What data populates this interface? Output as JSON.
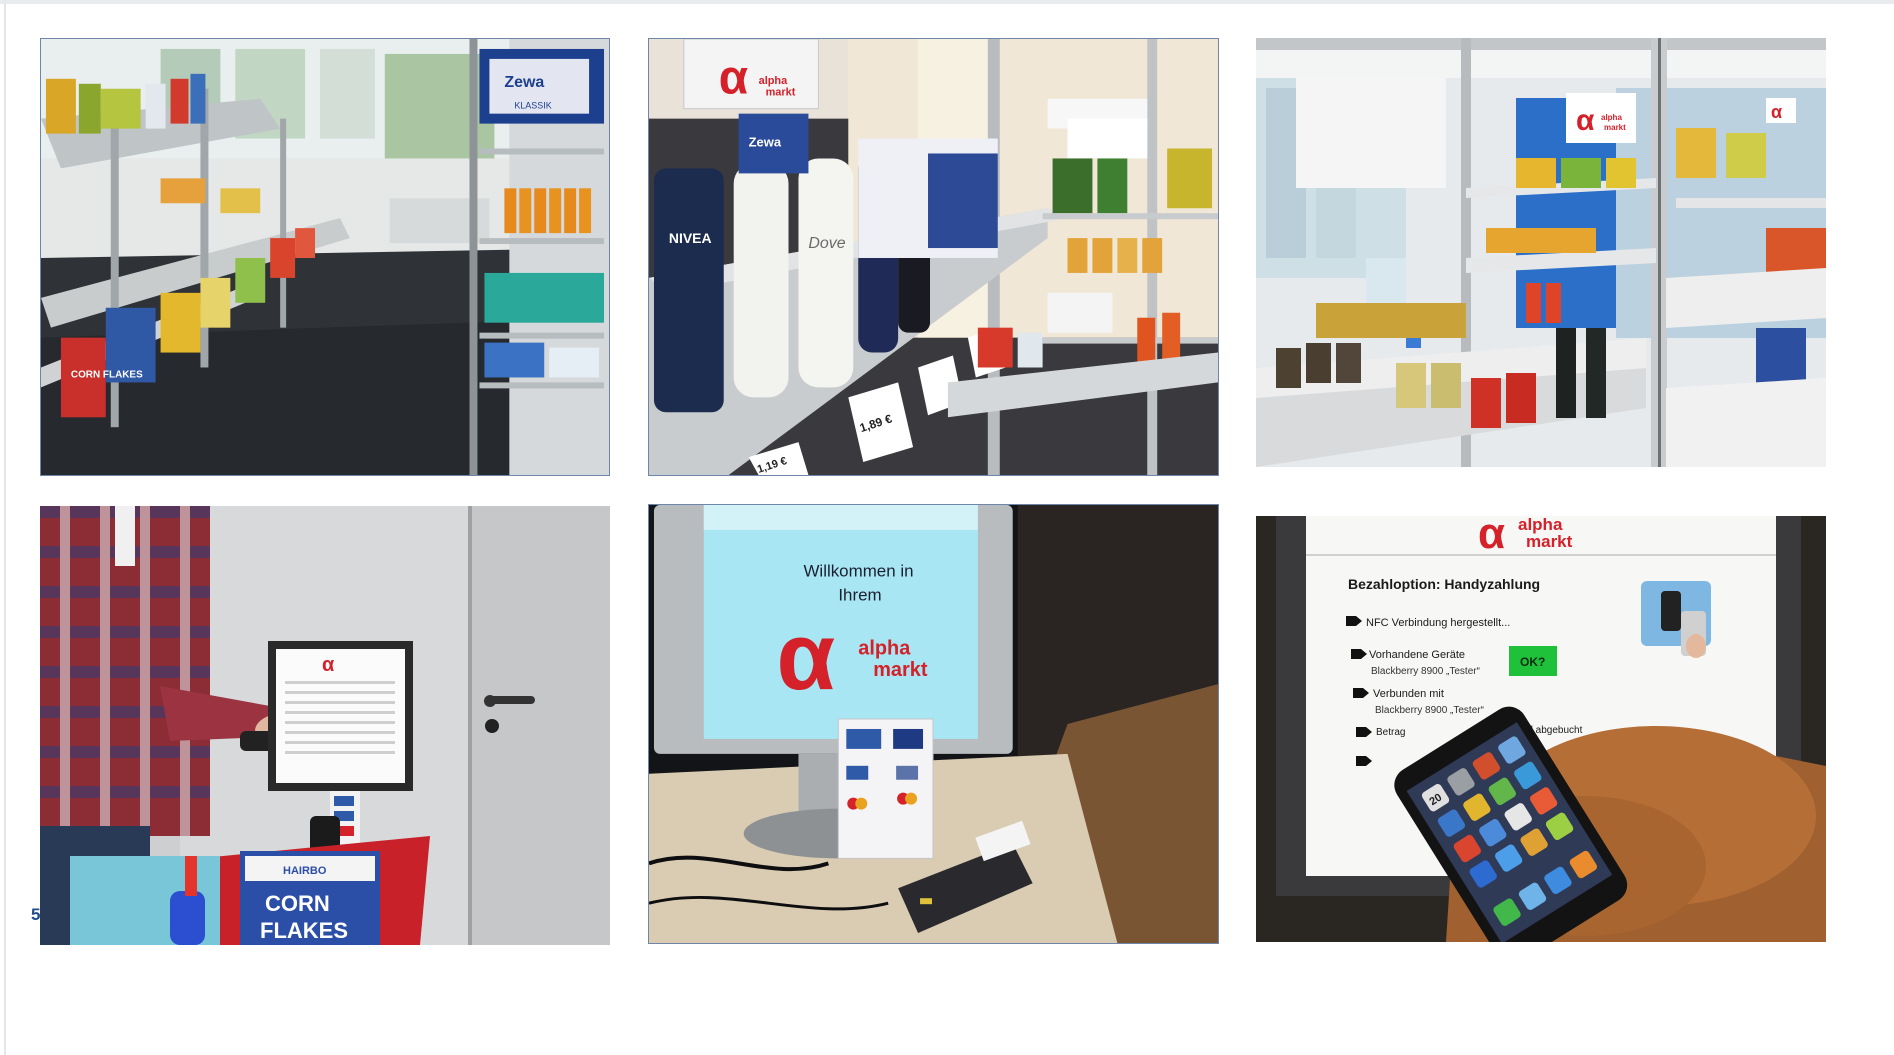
{
  "slide": {
    "page_number": "5"
  },
  "photos": {
    "shelves_front": {
      "icon": "store-shelves-photo",
      "product_labels": [
        "Zewa",
        "KLASSIK",
        "CORN FLAKES"
      ]
    },
    "shelves_close": {
      "icon": "store-shelf-closeup-photo",
      "logo_alpha": "α",
      "logo_word1": "alpha",
      "logo_word2": "markt",
      "product_labels": [
        "NIVEA",
        "Dove",
        "Zewa"
      ],
      "price_tag": "1,89 €",
      "price_tag_2": "1,19 €"
    },
    "shelves_side": {
      "icon": "store-aisle-photo",
      "logo_alpha": "α",
      "logo_word1": "alpha",
      "logo_word2": "markt"
    },
    "checkout_customer": {
      "icon": "self-checkout-photo",
      "product_labels": [
        "HAIRBO",
        "CORN",
        "FLAKES"
      ]
    },
    "welcome_terminal": {
      "icon": "welcome-monitor-photo",
      "welcome_line1": "Willkommen in",
      "welcome_line2": "Ihrem",
      "logo_alpha": "α",
      "logo_word1": "alpha",
      "logo_word2": "markt"
    },
    "mobile_payment": {
      "icon": "mobile-payment-photo",
      "logo_alpha": "α",
      "logo_word1": "alpha",
      "logo_word2": "markt",
      "heading": "Bezahloption: Handyzahlung",
      "step1": "NFC Verbindung hergestellt...",
      "step2": "Vorhandene Geräte",
      "step2_detail": "Blackberry 8900 „Tester“",
      "ok_button": "OK?",
      "step3": "Verbunden mit",
      "step3_detail": "Blackberry 8900 „Tester“",
      "step4_start": "Betrag",
      "step4_end": "rd abgebucht",
      "phone_date": "20"
    }
  },
  "colors": {
    "brand_red": "#d4212a",
    "ok_green": "#1fc13a",
    "page_number_blue": "#1f4e8c",
    "screen_cyan": "#a7e6f2",
    "photo_border": "#6f86aa"
  }
}
